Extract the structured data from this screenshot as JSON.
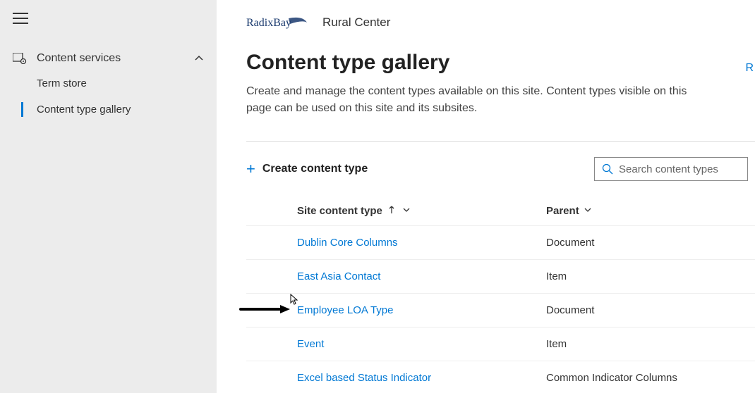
{
  "sidebar": {
    "sectionLabel": "Content services",
    "items": [
      {
        "label": "Term store",
        "active": false
      },
      {
        "label": "Content type gallery",
        "active": true
      }
    ]
  },
  "header": {
    "logoText": "RadixBay",
    "siteName": "Rural Center"
  },
  "page": {
    "title": "Content type gallery",
    "description": "Create and manage the content types available on this site. Content types visible on this page can be used on this site and its subsites.",
    "topRightLinkFragment": "R"
  },
  "actions": {
    "createLabel": "Create content type",
    "searchPlaceholder": "Search content types"
  },
  "table": {
    "columns": {
      "name": "Site content type",
      "parent": "Parent"
    },
    "rows": [
      {
        "name": "Dublin Core Columns",
        "parent": "Document",
        "highlighted": false
      },
      {
        "name": "East Asia Contact",
        "parent": "Item",
        "highlighted": false
      },
      {
        "name": "Employee LOA Type",
        "parent": "Document",
        "highlighted": true
      },
      {
        "name": "Event",
        "parent": "Item",
        "highlighted": false
      },
      {
        "name": "Excel based Status Indicator",
        "parent": "Common Indicator Columns",
        "highlighted": false
      }
    ]
  }
}
